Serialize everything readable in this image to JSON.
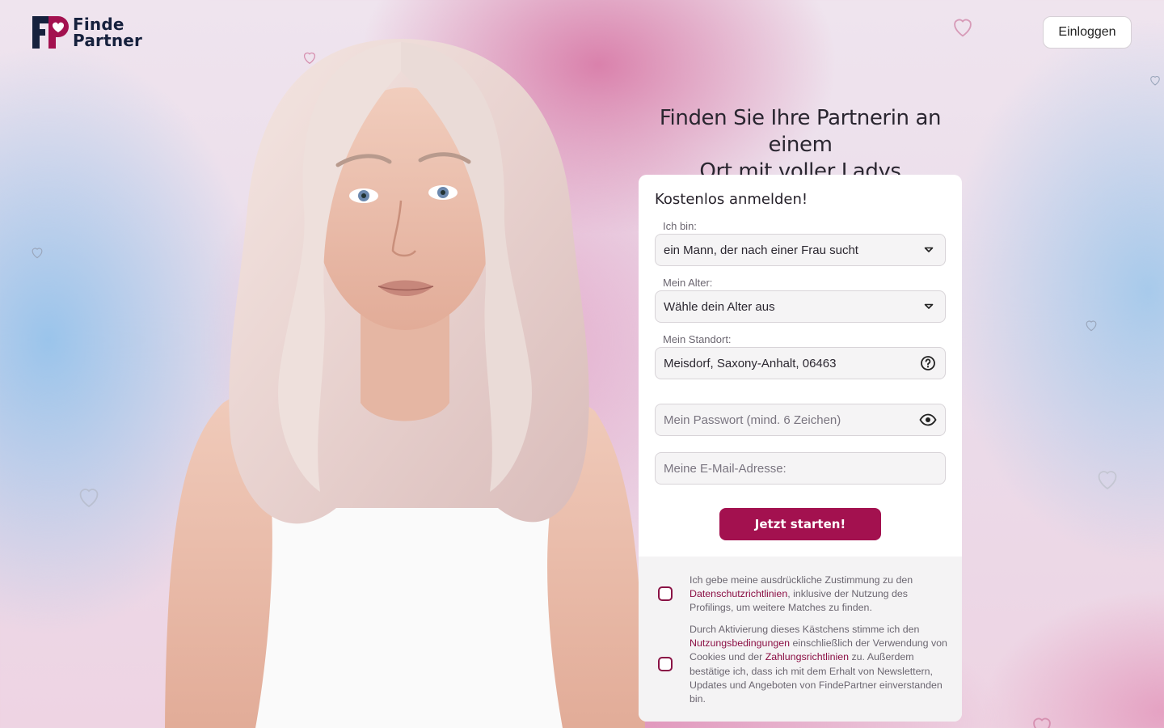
{
  "brand": {
    "line1": "Finde",
    "line2": "Partner"
  },
  "header": {
    "login_label": "Einloggen"
  },
  "hero": {
    "headline_line1": "Finden Sie Ihre Partnerin an einem",
    "headline_line2": "Ort mit voller Ladys"
  },
  "form": {
    "title": "Kostenlos anmelden!",
    "iam": {
      "label": "Ich bin:",
      "value": "ein Mann, der nach einer Frau sucht"
    },
    "age": {
      "label": "Mein Alter:",
      "value": "Wähle dein Alter aus"
    },
    "location": {
      "label": "Mein Standort:",
      "value": "Meisdorf, Saxony-Anhalt, 06463"
    },
    "password": {
      "placeholder": "Mein Passwort (mind. 6 Zeichen)"
    },
    "email": {
      "placeholder": "Meine E-Mail-Adresse:"
    },
    "submit_label": "Jetzt starten!"
  },
  "consent": {
    "privacy": {
      "before": "Ich gebe meine ausdrückliche Zustimmung zu den ",
      "link": "Datenschutzrichtlinien",
      "after": ", inklusive der Nutzung des Profilings, um weitere Matches zu finden."
    },
    "terms": {
      "before": "Durch Aktivierung dieses Kästchens stimme ich den ",
      "link1": "Nutzungsbedingungen",
      "middle": " einschließlich der Verwendung von Cookies und der ",
      "link2": "Zahlungsrichtlinien",
      "after": " zu. Außerdem bestätige ich, dass ich mit dem Erhalt von Newslettern, Updates und Angeboten von FindePartner einverstanden bin."
    }
  },
  "colors": {
    "accent": "#a3114f",
    "link": "#8b1045",
    "logo_navy": "#16213d"
  },
  "icons": [
    "heart-logo-icon",
    "chevron-down-icon",
    "help-circle-icon",
    "eye-icon",
    "heart-outline-icon"
  ]
}
